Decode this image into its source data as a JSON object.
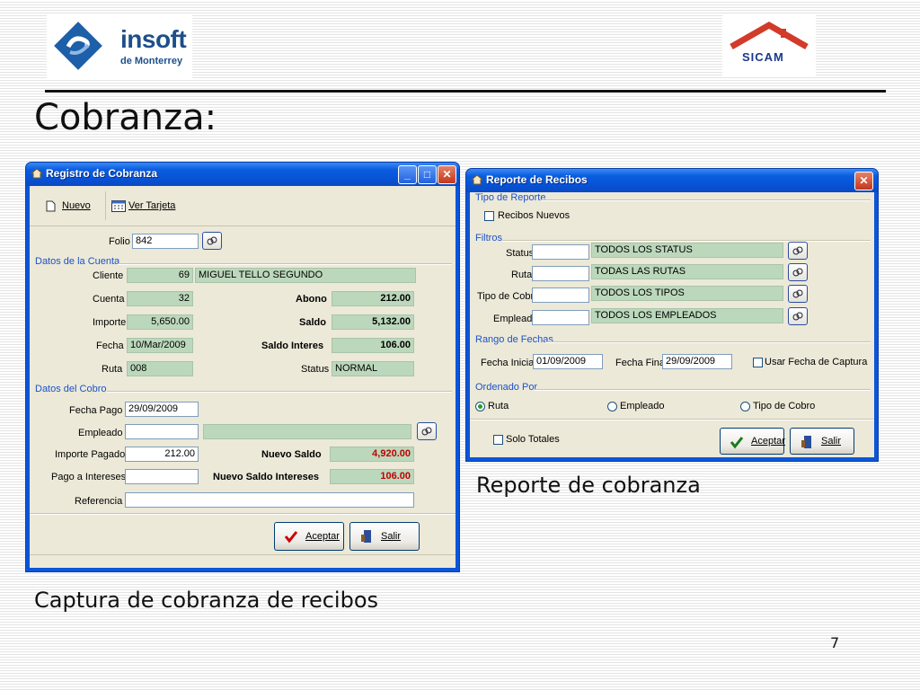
{
  "logos": {
    "insoft_name": "insoft",
    "insoft_sub": "de Monterrey",
    "sicam": "SICAM"
  },
  "slide": {
    "title": "Cobranza:",
    "caption_left": "Captura de cobranza de recibos",
    "caption_right": "Reporte de cobranza",
    "page_number": "7"
  },
  "registro": {
    "title": "Registro de Cobranza",
    "toolbar": {
      "nuevo": "Nuevo",
      "ver_tarjeta": "Ver Tarjeta"
    },
    "folio_label": "Folio",
    "folio": "842",
    "datos_cuenta": "Datos de la Cuenta",
    "cliente_label": "Cliente",
    "cliente_id": "69",
    "cliente_nombre": "MIGUEL TELLO SEGUNDO",
    "cuenta_label": "Cuenta",
    "cuenta": "32",
    "abono_label": "Abono",
    "abono": "212.00",
    "importe_label": "Importe",
    "importe": "5,650.00",
    "saldo_label": "Saldo",
    "saldo": "5,132.00",
    "fecha_label": "Fecha",
    "fecha": "10/Mar/2009",
    "saldo_interes_label": "Saldo Interes",
    "saldo_interes": "106.00",
    "ruta_label": "Ruta",
    "ruta": "008",
    "status_label": "Status",
    "status": "NORMAL",
    "datos_cobro": "Datos del Cobro",
    "fecha_pago_label": "Fecha Pago",
    "fecha_pago": "29/09/2009",
    "empleado_label": "Empleado",
    "empleado": "",
    "importe_pagado_label": "Importe Pagado",
    "importe_pagado": "212.00",
    "nuevo_saldo_label": "Nuevo Saldo",
    "nuevo_saldo": "4,920.00",
    "pago_intereses_label": "Pago a Intereses",
    "pago_intereses": "",
    "nuevo_saldo_intereses_label": "Nuevo Saldo Intereses",
    "nuevo_saldo_intereses": "106.00",
    "referencia_label": "Referencia",
    "referencia": "",
    "aceptar": "Aceptar",
    "salir": "Salir"
  },
  "reporte": {
    "title": "Reporte de Recibos",
    "tipo_reporte": "Tipo de Reporte",
    "recibos_nuevos": "Recibos Nuevos",
    "filtros": "Filtros",
    "status_label": "Status",
    "status_value": "TODOS LOS STATUS",
    "ruta_label": "Ruta",
    "ruta_value": "TODAS LAS RUTAS",
    "tipo_cobro_label": "Tipo de Cobro",
    "tipo_cobro_value": "TODOS LOS TIPOS",
    "empleado_label": "Empleado",
    "empleado_value": "TODOS LOS EMPLEADOS",
    "rango_fechas": "Rango de Fechas",
    "fecha_inicial_label": "Fecha Inicial",
    "fecha_inicial": "01/09/2009",
    "fecha_final_label": "Fecha Final",
    "fecha_final": "29/09/2009",
    "usar_fecha_captura": "Usar Fecha de Captura",
    "ordenado_por": "Ordenado Por",
    "opt_ruta": "Ruta",
    "opt_empleado": "Empleado",
    "opt_tipo_cobro": "Tipo de Cobro",
    "solo_totales": "Solo Totales",
    "aceptar": "Aceptar",
    "salir": "Salir"
  }
}
